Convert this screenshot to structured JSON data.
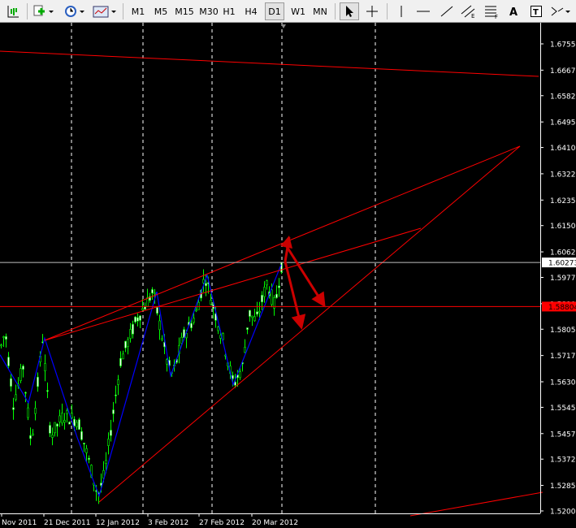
{
  "toolbar": {
    "timeframes": [
      "M1",
      "M5",
      "M15",
      "M30",
      "H1",
      "H4",
      "D1",
      "W1",
      "MN"
    ],
    "active_timeframe": "D1"
  },
  "chart_data": {
    "type": "candlestick",
    "price_axis": {
      "labels": [
        "1.67550",
        "1.66675",
        "1.65825",
        "1.64950",
        "1.64100",
        "1.63225",
        "1.62350",
        "1.61500",
        "1.60625",
        "1.59775",
        "1.58900",
        "1.58050",
        "1.57175",
        "1.56300",
        "1.55450",
        "1.54575",
        "1.53725",
        "1.52850",
        "1.52000"
      ],
      "range": [
        1.52,
        1.6755
      ]
    },
    "time_axis": {
      "labels": [
        "Nov 2011",
        "21 Dec 2011",
        "12 Jan 2012",
        "3 Feb 2012",
        "27 Feb 2012",
        "20 Mar 2012"
      ]
    },
    "current_price": "1.60273",
    "horizontal_level": "1.58804",
    "colors": {
      "background": "#000000",
      "candle_up": "#00ff00",
      "candle_down": "#ffffff",
      "trendline": "#ff0000",
      "zigzag": "#0000ff",
      "arrows": "#cc0000",
      "grid": "#ffffff",
      "bid_line": "#c0c0c0",
      "level_label_bg": "#ff0000"
    },
    "zigzag_prices": [
      1.572,
      1.556,
      1.5775,
      1.5445,
      1.525,
      1.593,
      1.565,
      1.5985,
      1.562,
      1.602
    ]
  }
}
